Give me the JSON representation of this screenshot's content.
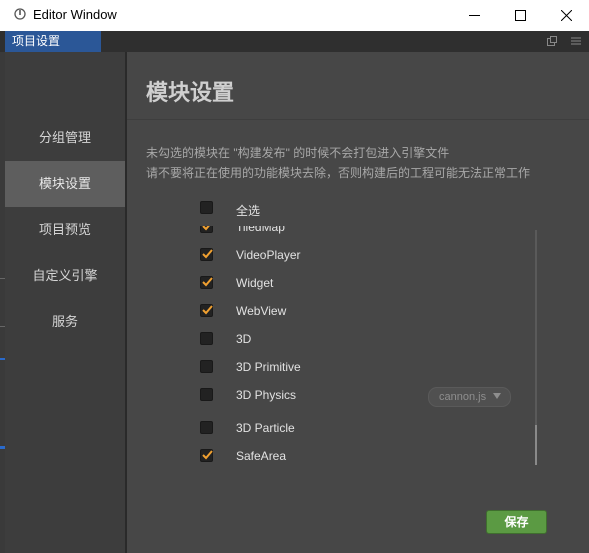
{
  "window": {
    "title": "Editor Window"
  },
  "tab": {
    "label": "项目设置"
  },
  "sidebar": {
    "items": [
      {
        "label": "分组管理"
      },
      {
        "label": "模块设置"
      },
      {
        "label": "项目预览"
      },
      {
        "label": "自定义引擎"
      },
      {
        "label": "服务"
      }
    ],
    "active_index": 1
  },
  "page": {
    "title": "模块设置",
    "desc_line1": "未勾选的模块在 \"构建发布\" 的时候不会打包进入引擎文件",
    "desc_line2": "请不要将正在使用的功能模块去除，否则构建后的工程可能无法正常工作"
  },
  "modules": {
    "select_all": {
      "label": "全选",
      "checked": false
    },
    "items": [
      {
        "label": "TiledMap",
        "checked": true
      },
      {
        "label": "VideoPlayer",
        "checked": true
      },
      {
        "label": "Widget",
        "checked": true
      },
      {
        "label": "WebView",
        "checked": true
      },
      {
        "label": "3D",
        "checked": false
      },
      {
        "label": "3D Primitive",
        "checked": false
      },
      {
        "label": "3D Physics",
        "checked": false
      },
      {
        "label": "3D Particle",
        "checked": false
      },
      {
        "label": "SafeArea",
        "checked": true
      }
    ],
    "physics_engine": "cannon.js"
  },
  "actions": {
    "save_label": "保存"
  },
  "colors": {
    "accent_tab": "#2b5797",
    "check_mark": "#f0a030",
    "save_button": "#5b9a43"
  }
}
